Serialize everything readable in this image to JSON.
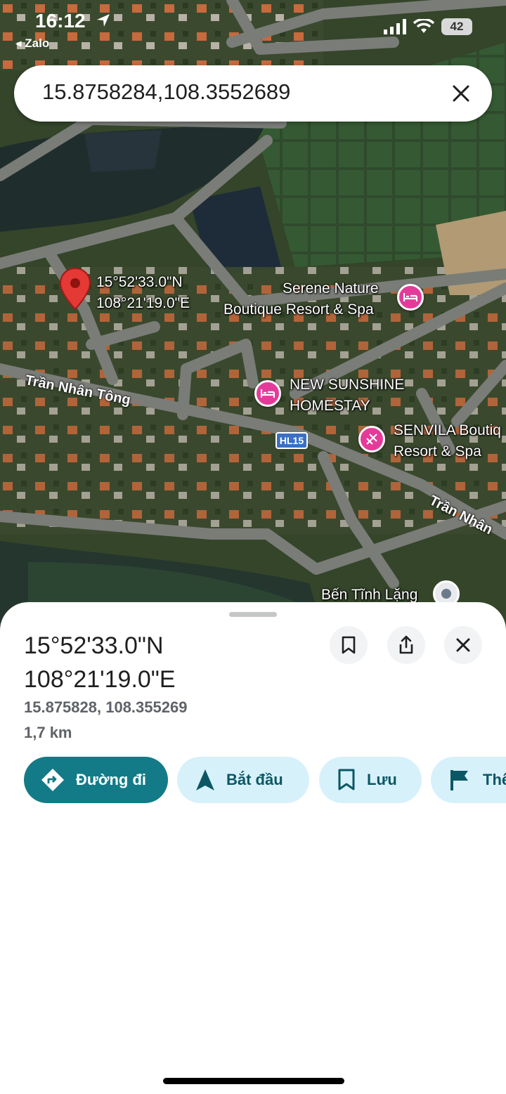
{
  "status_bar": {
    "time": "16:12",
    "back_app": "◂ Zalo",
    "battery": "42"
  },
  "search": {
    "query": "15.8758284,108.3552689"
  },
  "map": {
    "pin_label_lat": "15°52'33.0\"N",
    "pin_label_lng": "108°21'19.0\"E",
    "poi_serene_line1": "Serene Nature",
    "poi_serene_line2": "Boutique Resort & Spa",
    "poi_sunshine_line1": "NEW SUNSHINE",
    "poi_sunshine_line2": "HOMESTAY",
    "poi_senvila_line1": "SENVILA Boutiq",
    "poi_senvila_line2": "Resort & Spa",
    "poi_bentinhlang": "Bến Tĩnh Lặng",
    "road_tran_nhan_tong_1": "Trần Nhân Tông",
    "road_tran_nhan_tong_2": "Trần Nhân",
    "route_badge": "HL15"
  },
  "sheet": {
    "title_lat": "15°52'33.0\"N",
    "title_lng": "108°21'19.0\"E",
    "decimal_coords": "15.875828, 108.355269",
    "distance": "1,7 km",
    "actions": [
      {
        "label": "Đường đi",
        "icon": "directions-icon"
      },
      {
        "label": "Bắt đầu",
        "icon": "navigation-arrow-icon"
      },
      {
        "label": "Lưu",
        "icon": "bookmark-icon"
      },
      {
        "label": "Thê",
        "icon": "flag-icon"
      }
    ]
  },
  "colors": {
    "primary": "#137b87",
    "tonal": "#d7f1fb",
    "pin": "#e53935",
    "poi": "#e43b9a"
  }
}
